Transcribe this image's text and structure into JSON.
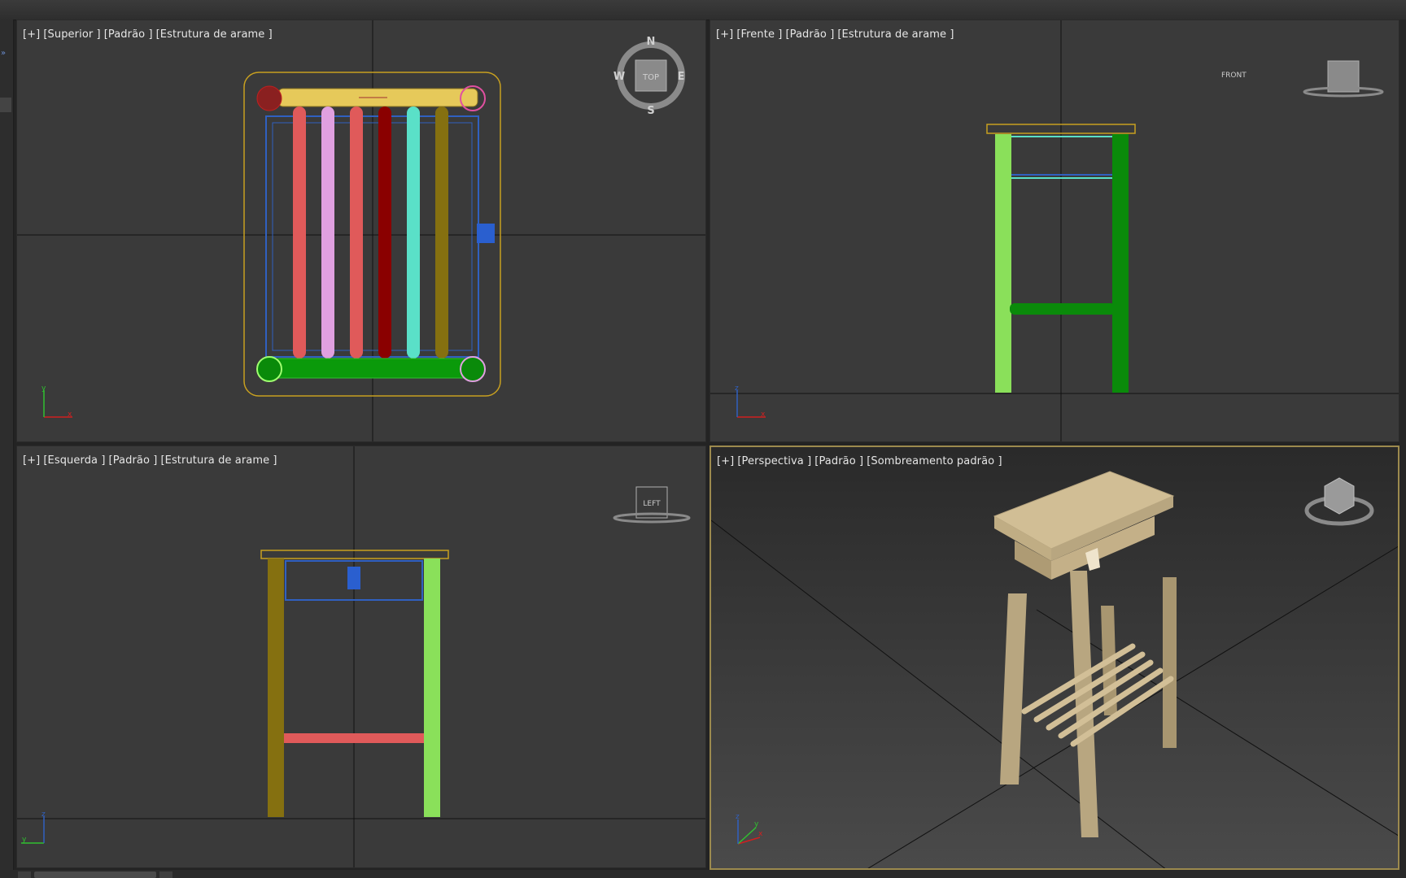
{
  "viewports": {
    "top": {
      "label": [
        "[+]",
        "[Superior ]",
        "[Padrão ]",
        "[Estrutura de arame ]"
      ],
      "compass": {
        "n": "N",
        "s": "S",
        "e": "E",
        "w": "W",
        "cube": "TOP"
      }
    },
    "front": {
      "label": [
        "[+]",
        "[Frente ]",
        "[Padrão ]",
        "[Estrutura de arame ]"
      ],
      "cube": "FRONT"
    },
    "left": {
      "label": [
        "[+]",
        "[Esquerda ]",
        "[Padrão ]",
        "[Estrutura de arame ]"
      ],
      "cube": "LEFT"
    },
    "perspective": {
      "label": [
        "[+]",
        "[Perspectiva ]",
        "[Padrão ]",
        "[Sombreamento padrão ]"
      ]
    }
  },
  "axes": {
    "x": "x",
    "y": "y",
    "z": "z"
  },
  "colors": {
    "viewport_bg": "#3a3a3a",
    "active_border": "#9c8a4e",
    "leg_light_green": "#8ae05a",
    "leg_dark_green": "#0a8a0a",
    "leg_olive": "#857010",
    "slat_red": "#e05a5a",
    "slat_pink": "#e0a0e0",
    "slat_darkred": "#8a0000",
    "slat_cyan": "#5ae0c8",
    "wire_blue": "#3060c0",
    "top_yellow": "#e6c95a",
    "wood": "#c8b48a"
  }
}
